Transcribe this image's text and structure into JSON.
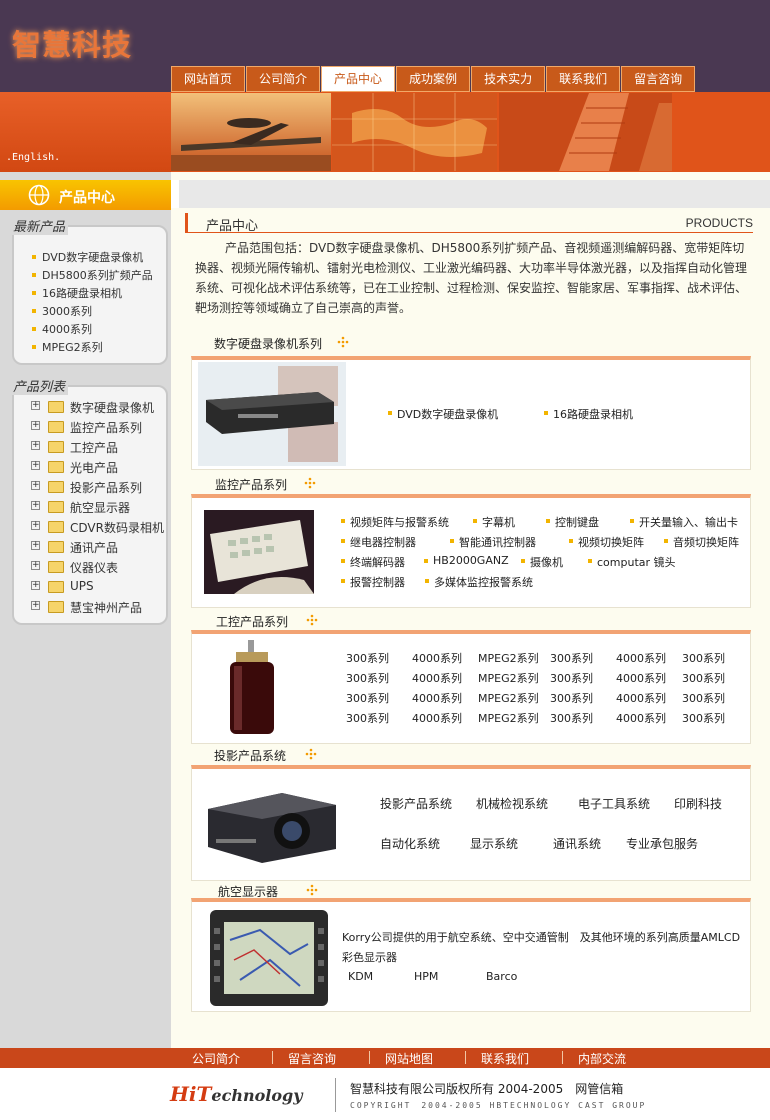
{
  "brand": {
    "logo": "智慧科技",
    "english_link": ".English."
  },
  "nav": [
    "网站首页",
    "公司简介",
    "产品中心",
    "成功案例",
    "技术实力",
    "联系我们",
    "留言咨询"
  ],
  "sidebar": {
    "title": "产品中心",
    "latest_title": "最新产品",
    "latest": [
      "DVD数字硬盘录像机",
      "DH5800系列扩频产品",
      "16路硬盘录相机",
      "3000系列",
      "4000系列",
      "MPEG2系列"
    ],
    "list_title": "产品列表",
    "list": [
      "数字硬盘录像机",
      "监控产品系列",
      "工控产品",
      "光电产品",
      "投影产品系列",
      "航空显示器",
      "CDVR数码录相机",
      "通讯产品",
      "仪器仪表",
      "UPS",
      "慧宝神州产品"
    ]
  },
  "main": {
    "title_zh": "产品中心",
    "title_en": "PRODUCTS",
    "intro": "产品范围包括：DVD数字硬盘录像机、DH5800系列扩频产品、音视频遥测编解码器、宽带矩阵切换器、视频光隔传输机、镭射光电检测仪、工业激光编码器、大功率半导体激光器，以及指挥自动化管理系统、可视化战术评估系统等，已在工业控制、过程检测、保安监控、智能家居、军事指挥、战术评估、靶场测控等领域确立了自己崇高的声誉。",
    "sections": [
      {
        "title": "数字硬盘录像机系列",
        "items": [
          "DVD数字硬盘录像机",
          "16路硬盘录相机"
        ]
      },
      {
        "title": "监控产品系列",
        "items": [
          "视频矩阵与报警系统",
          "字幕机",
          "控制键盘",
          "开关量输入、输出卡",
          "继电器控制器",
          "智能通讯控制器",
          "视频切换矩阵",
          "音频切换矩阵",
          "终端解码器",
          "HB2000GANZ",
          "摄像机",
          "computar 镜头",
          "报警控制器",
          "多媒体监控报警系统"
        ]
      },
      {
        "title": "工控产品系列",
        "rows": [
          [
            "300系列",
            "4000系列",
            "MPEG2系列",
            "300系列",
            "4000系列",
            "300系列"
          ],
          [
            "300系列",
            "4000系列",
            "MPEG2系列",
            "300系列",
            "4000系列",
            "300系列"
          ],
          [
            "300系列",
            "4000系列",
            "MPEG2系列",
            "300系列",
            "4000系列",
            "300系列"
          ],
          [
            "300系列",
            "4000系列",
            "MPEG2系列",
            "300系列",
            "4000系列",
            "300系列"
          ]
        ]
      },
      {
        "title": "投影产品系统",
        "items": [
          "投影产品系统",
          "机械检视系统",
          "电子工具系统",
          "印刷科技",
          "自动化系统",
          "显示系统",
          "通讯系统",
          "专业承包服务"
        ]
      },
      {
        "title": "航空显示器",
        "desc": "Korry公司提供的用于航空系统、空中交通管制　及其他环境的系列高质量AMLCD彩色显示器",
        "brands": [
          "KDM",
          "HPM",
          "Barco"
        ]
      }
    ]
  },
  "footer": {
    "nav": [
      "公司简介",
      "留言咨询",
      "网站地图",
      "联系我们",
      "内部交流"
    ],
    "logo_hit": "HiT",
    "logo_text": "echnology",
    "copyright": "智慧科技有限公司版权所有 2004-2005　网管信箱",
    "copyright_en": "COPYRIGHT　2004-2005 HBTECHNOLOGY CAST GROUP"
  },
  "colors": {
    "header": "#4a3852",
    "accent": "#e0541a",
    "nav": "#c85a1a",
    "sidebar": "#d9d9d9",
    "main_bg": "#fdfcef",
    "bullet": "#f2b400"
  }
}
